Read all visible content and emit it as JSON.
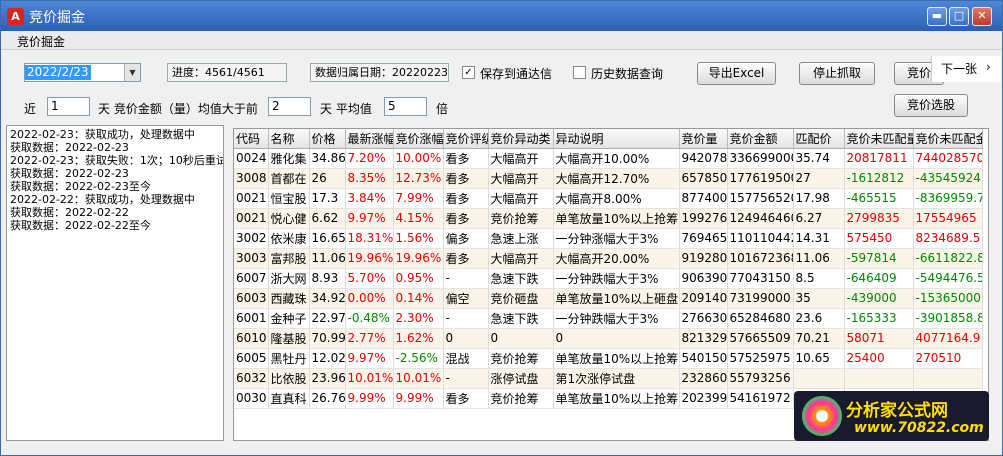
{
  "window": {
    "title": "竞价掘金",
    "app_icon": "A"
  },
  "menu": {
    "label": "竞价掘金"
  },
  "controls": {
    "date": "2022/2/23",
    "progress": "进度：4561/4561",
    "data_date": "数据归属日期：20220223",
    "save_label": "保存到通达信",
    "history_label": "历史数据查询",
    "export_label": "导出Excel",
    "stop_label": "停止抓取",
    "bid_partial": "竞价",
    "select_label": "竞价选股",
    "next_label": "下一张",
    "recent_prefix": "近",
    "recent_days": "1",
    "avg_text": "天 竞价金额（量）均值大于前",
    "prev_days": "2",
    "avg_suffix": "天  平均值",
    "multiple": "5",
    "times": "倍"
  },
  "log": [
    "2022-02-23：获取成功，处理数据中",
    "获取数据：2022-02-23",
    "2022-02-23：获取失败：1次；10秒后重试",
    "获取数据：2022-02-23",
    "获取数据：2022-02-23至今",
    "2022-02-22：获取成功，处理数据中",
    "获取数据：2022-02-22",
    "获取数据：2022-02-22至今"
  ],
  "table": {
    "headers": [
      "代码",
      "名称",
      "价格",
      "最新涨幅",
      "竞价涨幅",
      "竞价评级",
      "竞价异动类",
      "异动说明",
      "竞价量",
      "竞价金额",
      "匹配价",
      "竞价未匹配量",
      "竞价未匹配金"
    ],
    "rows": [
      [
        "0024",
        "雅化集",
        "34.86",
        "7.20%",
        "10.00%",
        "看多",
        "大幅高开",
        "大幅高开10.00%",
        "942078",
        "336699000",
        "35.74",
        "20817811",
        "744028570"
      ],
      [
        "3008",
        "首都在",
        "26",
        "8.35%",
        "12.73%",
        "看多",
        "大幅高开",
        "大幅高开12.70%",
        "657850",
        "177619500",
        "27",
        "-1612812",
        "-43545924"
      ],
      [
        "0021",
        "恒宝股",
        "17.3",
        "3.84%",
        "7.99%",
        "看多",
        "大幅高开",
        "大幅高开8.00%",
        "877400",
        "157756520",
        "17.98",
        "-465515",
        "-8369959.7"
      ],
      [
        "0021",
        "悦心健",
        "6.62",
        "9.97%",
        "4.15%",
        "看多",
        "竞价抢筹",
        "单笔放量10%以上抢筹",
        "199276",
        "124946460",
        "6.27",
        "2799835",
        "17554965"
      ],
      [
        "3002",
        "依米康",
        "16.65",
        "18.31%",
        "1.56%",
        "偏多",
        "急速上涨",
        "一分钟涨幅大于3%",
        "769465",
        "110110442",
        "14.31",
        "575450",
        "8234689.5"
      ],
      [
        "3003",
        "富邦股",
        "11.06",
        "19.96%",
        "19.96%",
        "看多",
        "大幅高开",
        "大幅高开20.00%",
        "919280",
        "101672368",
        "11.06",
        "-597814",
        "-6611822.8"
      ],
      [
        "6007",
        "浙大网",
        "8.93",
        "5.70%",
        "0.95%",
        "-",
        "急速下跌",
        "一分钟跌幅大于3%",
        "906390",
        "77043150",
        "8.5",
        "-646409",
        "-5494476.5"
      ],
      [
        "6003",
        "西藏珠",
        "34.92",
        "0.00%",
        "0.14%",
        "偏空",
        "竞价砸盘",
        "单笔放量10%以上砸盘",
        "209140",
        "73199000",
        "35",
        "-439000",
        "-15365000"
      ],
      [
        "6001",
        "金种子",
        "22.97",
        "-0.48%",
        "2.30%",
        "-",
        "急速下跌",
        "一分钟跌幅大于3%",
        "276630",
        "65284680",
        "23.6",
        "-165333",
        "-3901858.8"
      ],
      [
        "6010",
        "隆基股",
        "70.99",
        "2.77%",
        "1.62%",
        "0",
        "0",
        "0",
        "821329",
        "57665509",
        "70.21",
        "58071",
        "4077164.9"
      ],
      [
        "6005",
        "黑牡丹",
        "12.02",
        "9.97%",
        "-2.56%",
        "混战",
        "竞价抢筹",
        "单笔放量10%以上抢筹",
        "540150",
        "57525975",
        "10.65",
        "25400",
        "270510"
      ],
      [
        "6032",
        "比依股",
        "23.96",
        "10.01%",
        "10.01%",
        "-",
        "涨停试盘",
        "第1次涨停试盘",
        "232860",
        "55793256",
        "",
        "",
        ""
      ],
      [
        "0030",
        "直真科",
        "26.76",
        "9.99%",
        "9.99%",
        "看多",
        "竞价抢筹",
        "单笔放量10%以上抢筹",
        "202399",
        "54161972",
        "",
        "",
        ""
      ]
    ]
  },
  "logo": {
    "line1": "分析家公式网",
    "line2": "www.70822.com"
  },
  "colors": {
    "up": "#e00000",
    "down": "#008800",
    "title_bar": "#2a5fb8",
    "selection": "#3399ff"
  }
}
